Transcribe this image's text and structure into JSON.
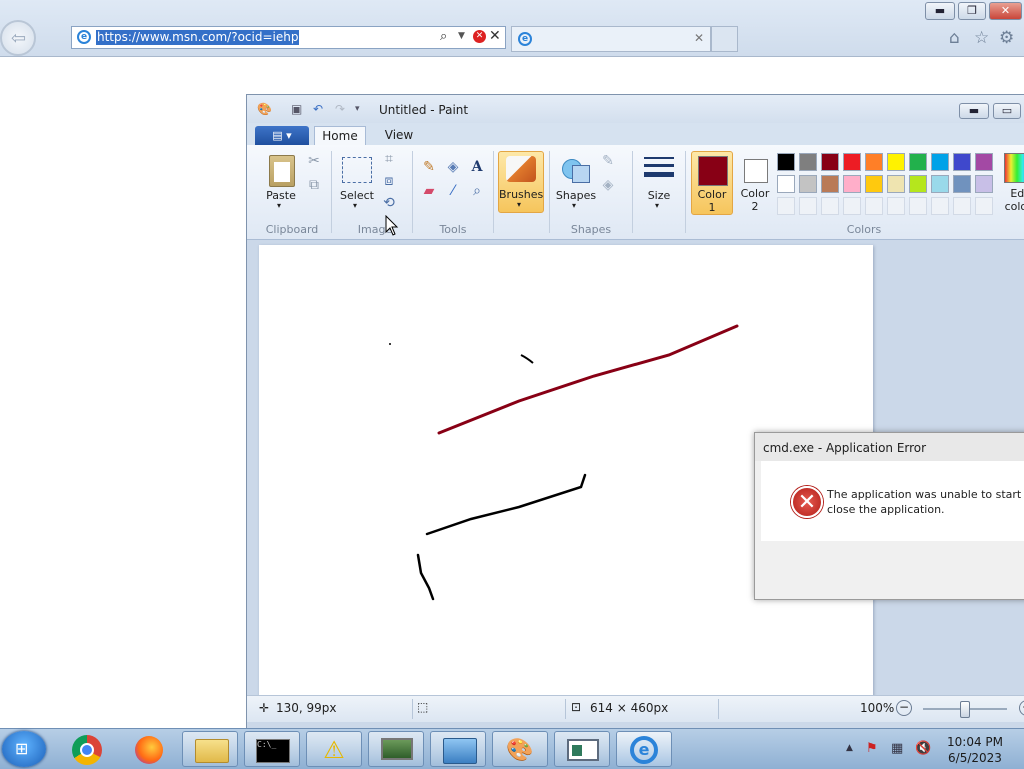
{
  "browser": {
    "url": "https://www.msn.com/?ocid=iehp",
    "tab_title": "",
    "window_controls": [
      "minimize",
      "restore",
      "close"
    ],
    "tool_icons": [
      "home-icon",
      "star-icon",
      "gear-icon"
    ]
  },
  "paint": {
    "title": "Untitled - Paint",
    "file_menu_label": "▾",
    "tabs": [
      "Home",
      "View"
    ],
    "groups": {
      "clipboard": {
        "label": "Clipboard",
        "paste": "Paste"
      },
      "image": {
        "label": "Image",
        "select": "Select"
      },
      "tools": {
        "label": "Tools"
      },
      "brushes": {
        "label": "Brushes"
      },
      "shapes": {
        "label": "Shapes",
        "shapes_button": "Shapes"
      },
      "size": {
        "label": "Size"
      },
      "colors": {
        "label": "Colors",
        "color1": "Color",
        "color1_num": "1",
        "color2": "Color",
        "color2_num": "2",
        "edit": "Edit",
        "edit2": "colors",
        "color1_value": "#880015",
        "color2_value": "#ffffff",
        "palette_row1": [
          "#000000",
          "#7f7f7f",
          "#880015",
          "#ed1c24",
          "#ff7f27",
          "#fff200",
          "#22b14c",
          "#00a2e8",
          "#3f48cc",
          "#a349a4"
        ],
        "palette_row2": [
          "#ffffff",
          "#c3c3c3",
          "#b97a57",
          "#ffaec9",
          "#ffc90e",
          "#efe4b0",
          "#b5e61d",
          "#99d9ea",
          "#7092be",
          "#c8bfe7"
        ]
      }
    },
    "status": {
      "cursor_pos": "130, 99px",
      "selection_size": "",
      "canvas_size": "614 × 460px",
      "zoom": "100%"
    }
  },
  "dialog": {
    "title": "cmd.exe - Application Error",
    "message_line1": "The application was unable to start co",
    "message_line2": "close the application."
  },
  "taskbar": {
    "items": [
      "chrome-icon",
      "firefox-icon",
      "explorer-icon",
      "cmd-icon",
      "warning-icon",
      "monitor-icon",
      "network-icon",
      "paint-icon",
      "window-icon",
      "ie-icon"
    ],
    "time": "10:04 PM",
    "date": "6/5/2023"
  }
}
